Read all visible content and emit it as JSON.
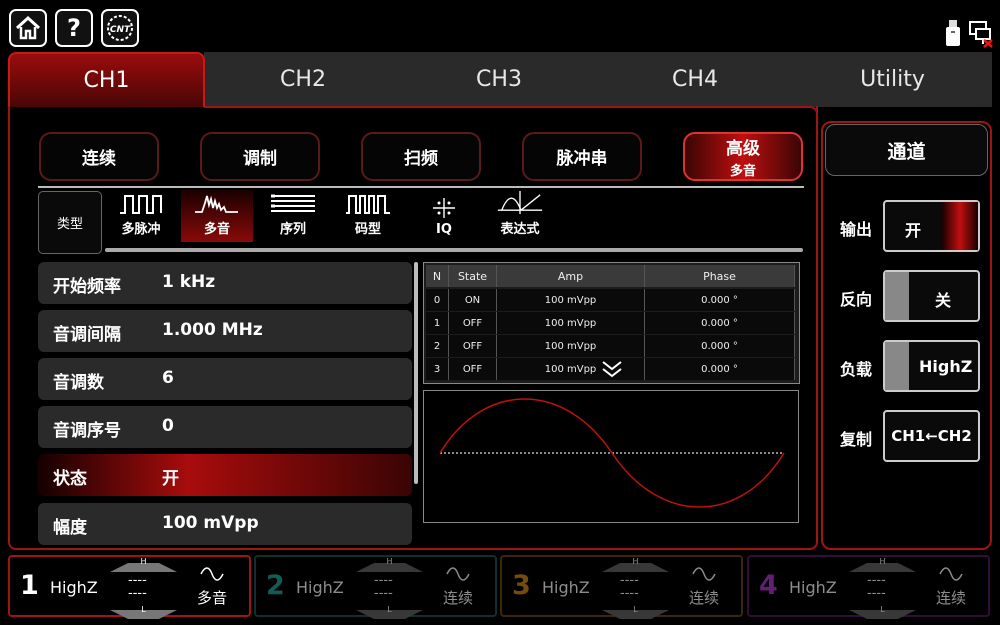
{
  "topbar": {
    "home_icon": "home-icon",
    "help_label": "?",
    "logo_label": "CNT"
  },
  "tabs": [
    "CH1",
    "CH2",
    "CH3",
    "CH4",
    "Utility"
  ],
  "modes": [
    {
      "label": "连续",
      "sub": ""
    },
    {
      "label": "调制",
      "sub": ""
    },
    {
      "label": "扫频",
      "sub": ""
    },
    {
      "label": "脉冲串",
      "sub": ""
    },
    {
      "label": "高级",
      "sub": "多音"
    }
  ],
  "type_label": "类型",
  "types": [
    "多脉冲",
    "多音",
    "序列",
    "码型",
    "IQ",
    "表达式"
  ],
  "params": [
    {
      "label": "开始频率",
      "value": "1 kHz"
    },
    {
      "label": "音调间隔",
      "value": "1.000 MHz"
    },
    {
      "label": "音调数",
      "value": "6"
    },
    {
      "label": "音调序号",
      "value": "0"
    },
    {
      "label": "状态",
      "value": "开"
    },
    {
      "label": "幅度",
      "value": "100 mVpp"
    }
  ],
  "table": {
    "headers": [
      "N",
      "State",
      "Amp",
      "Phase"
    ],
    "rows": [
      [
        "0",
        "ON",
        "100 mVpp",
        "0.000 °"
      ],
      [
        "1",
        "OFF",
        "100 mVpp",
        "0.000 °"
      ],
      [
        "2",
        "OFF",
        "100 mVpp",
        "0.000 °"
      ],
      [
        "3",
        "OFF",
        "100 mVpp",
        "0.000 °"
      ]
    ]
  },
  "side": {
    "title": "通道",
    "output_label": "输出",
    "output_value": "开",
    "invert_label": "反向",
    "invert_value": "关",
    "load_label": "负载",
    "load_value": "HighZ",
    "copy_label": "复制",
    "copy_value": "CH1←CH2"
  },
  "channels": [
    {
      "num": "1",
      "imp": "HighZ",
      "mode": "多音",
      "color": "#ffffff",
      "h": "H",
      "l": "L",
      "dash": "----"
    },
    {
      "num": "2",
      "imp": "HighZ",
      "mode": "连续",
      "color": "#1fa89a",
      "h": "H",
      "l": "L",
      "dash": "----"
    },
    {
      "num": "3",
      "imp": "HighZ",
      "mode": "连续",
      "color": "#d38a1a",
      "h": "H",
      "l": "L",
      "dash": "----"
    },
    {
      "num": "4",
      "imp": "HighZ",
      "mode": "连续",
      "color": "#b23ad2",
      "h": "H",
      "l": "L",
      "dash": "----"
    }
  ],
  "colors": {
    "accent": "#c00f0f",
    "frame": "#a01414"
  }
}
